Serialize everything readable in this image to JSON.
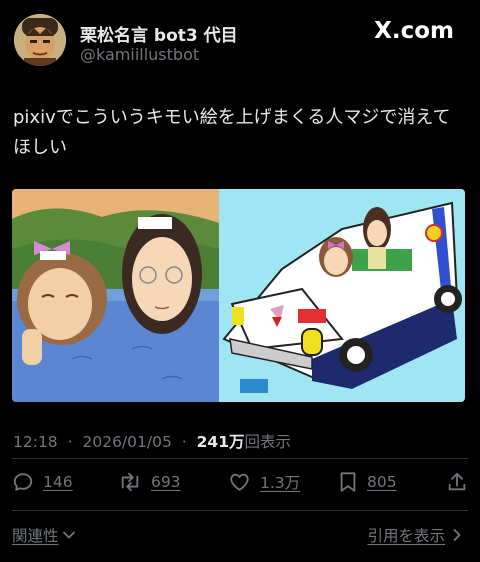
{
  "header": {
    "display_name": "栗松名言 bot3 代目",
    "handle": "@kamiillustbot",
    "brand": "X.com",
    "avatar_icon": "cartoon-face-avatar"
  },
  "tweet": {
    "text": "pixivでこういうキモい絵を上げまくる人マジで消えてほしい"
  },
  "meta": {
    "time": "12:18",
    "separator": "·",
    "date": "2026/01/05",
    "views": "241万",
    "views_label": "回表示"
  },
  "actions": {
    "replies": "146",
    "reposts": "693",
    "likes": "1.3万",
    "bookmarks": "805"
  },
  "footer": {
    "related": "関連性",
    "quotes": "引用を表示"
  },
  "colors": {
    "background": "#000000",
    "text": "#e7e9ea",
    "muted": "#71767b",
    "divider": "#2f3336"
  }
}
